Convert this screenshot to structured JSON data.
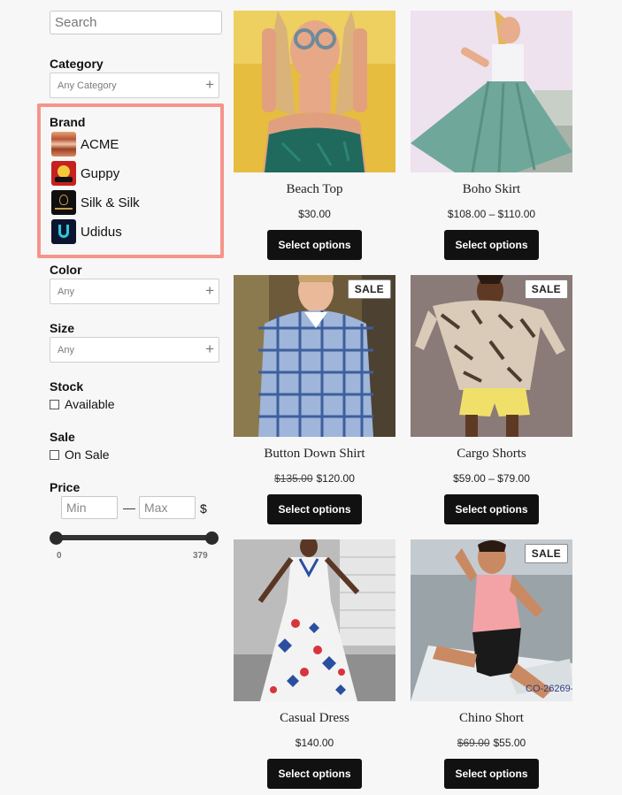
{
  "search": {
    "placeholder": "Search"
  },
  "filters": {
    "category": {
      "label": "Category",
      "placeholder": "Any Category"
    },
    "brand": {
      "label": "Brand",
      "items": [
        {
          "name": "ACME",
          "icon": "acme-logo-icon"
        },
        {
          "name": "Guppy",
          "icon": "guppy-logo-icon"
        },
        {
          "name": "Silk & Silk",
          "icon": "silk-and-silk-logo-icon"
        },
        {
          "name": "Udidus",
          "icon": "udidus-logo-icon"
        }
      ]
    },
    "color": {
      "label": "Color",
      "placeholder": "Any"
    },
    "size": {
      "label": "Size",
      "placeholder": "Any"
    },
    "stock": {
      "label": "Stock",
      "option": "Available"
    },
    "sale": {
      "label": "Sale",
      "option": "On Sale"
    },
    "price": {
      "label": "Price",
      "min_placeholder": "Min",
      "max_placeholder": "Max",
      "separator": "—",
      "currency": "$",
      "range_min": "0",
      "range_max": "379"
    }
  },
  "products": [
    {
      "title": "Beach Top",
      "price": "$30.00",
      "old_price": "",
      "sale": "",
      "button": "Select options"
    },
    {
      "title": "Boho Skirt",
      "price": "$108.00 – $110.00",
      "old_price": "",
      "sale": "",
      "button": "Select options"
    },
    {
      "title": "Button Down Shirt",
      "price": "$120.00",
      "old_price": "$135.00",
      "sale": "SALE",
      "button": "Select options"
    },
    {
      "title": "Cargo Shorts",
      "price": "$59.00 – $79.00",
      "old_price": "",
      "sale": "SALE",
      "button": "Select options"
    },
    {
      "title": "Casual Dress",
      "price": "$140.00",
      "old_price": "",
      "sale": "",
      "button": "Select options"
    },
    {
      "title": "Chino Short",
      "price": "$55.00",
      "old_price": "$69.00",
      "sale": "SALE",
      "button": "Select options"
    }
  ],
  "colors": {
    "highlight": "#f5958a",
    "button": "#111111",
    "background": "#f7f7f7"
  }
}
